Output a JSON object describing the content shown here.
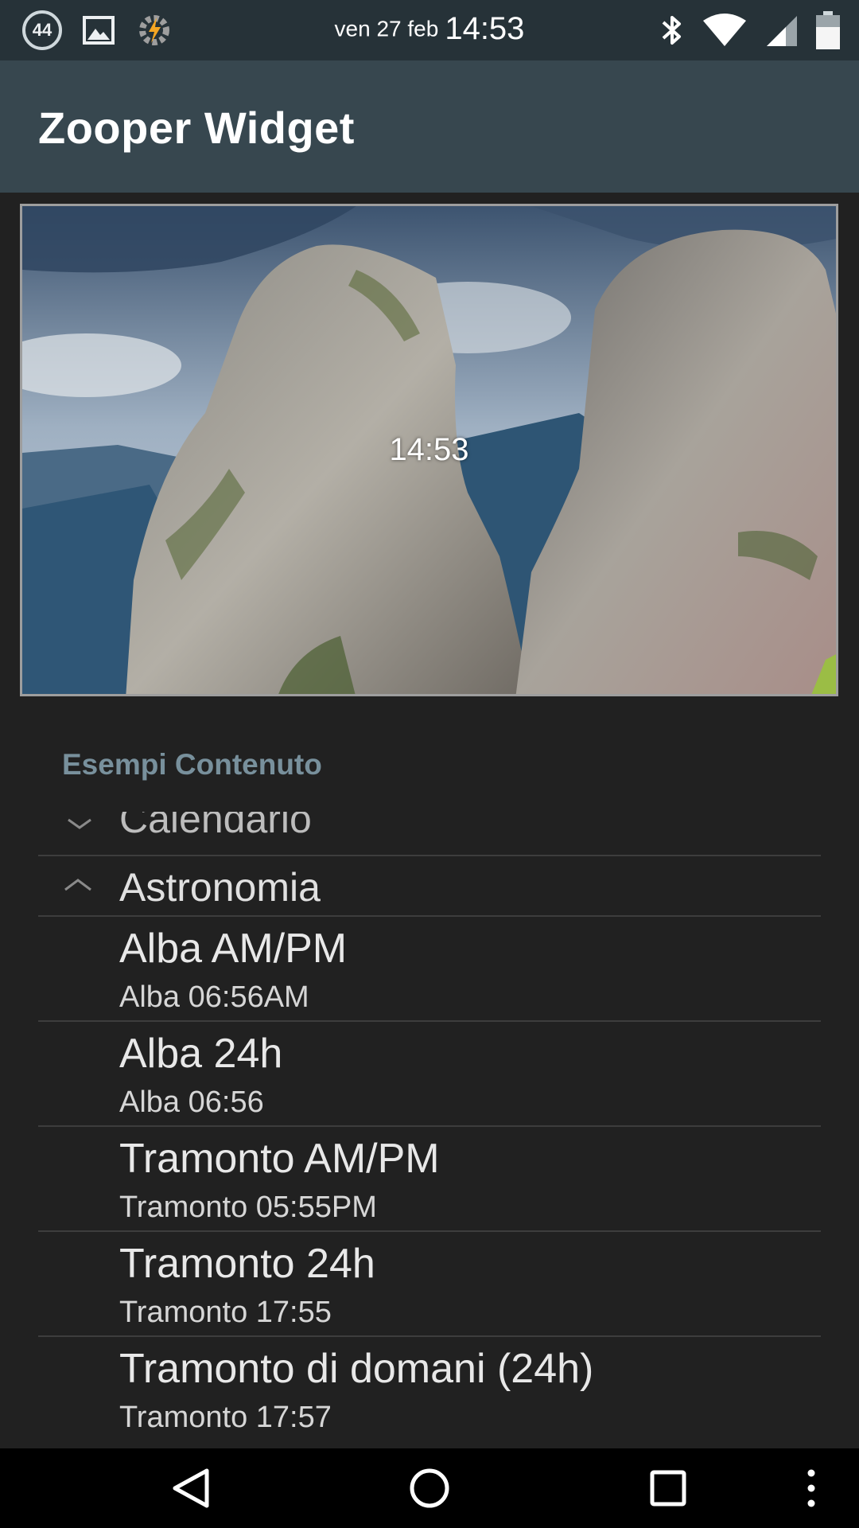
{
  "status_bar": {
    "notification_count": "44",
    "date": "ven 27 feb",
    "time": "14:53",
    "battery_level": 0.65,
    "icons": [
      "notification-count-badge",
      "gallery-icon",
      "tasker-icon",
      "bluetooth-icon",
      "wifi-icon",
      "cell-signal-icon",
      "battery-icon"
    ]
  },
  "app_bar": {
    "title": "Zooper Widget"
  },
  "preview": {
    "clock_text": "14:53"
  },
  "section": {
    "title": "Esempi Contenuto"
  },
  "list": {
    "previous_group": "Calendario",
    "current_group": "Astronomia",
    "items": [
      {
        "title": "Alba AM/PM",
        "subtitle": "Alba 06:56AM"
      },
      {
        "title": "Alba 24h",
        "subtitle": "Alba 06:56"
      },
      {
        "title": "Tramonto AM/PM",
        "subtitle": "Tramonto 05:55PM"
      },
      {
        "title": "Tramonto 24h",
        "subtitle": "Tramonto 17:55"
      },
      {
        "title": "Tramonto di domani (24h)",
        "subtitle": "Tramonto 17:57"
      }
    ]
  },
  "nav_bar": {
    "buttons": [
      "back-button",
      "home-button",
      "recents-button",
      "overflow-menu-button"
    ]
  }
}
